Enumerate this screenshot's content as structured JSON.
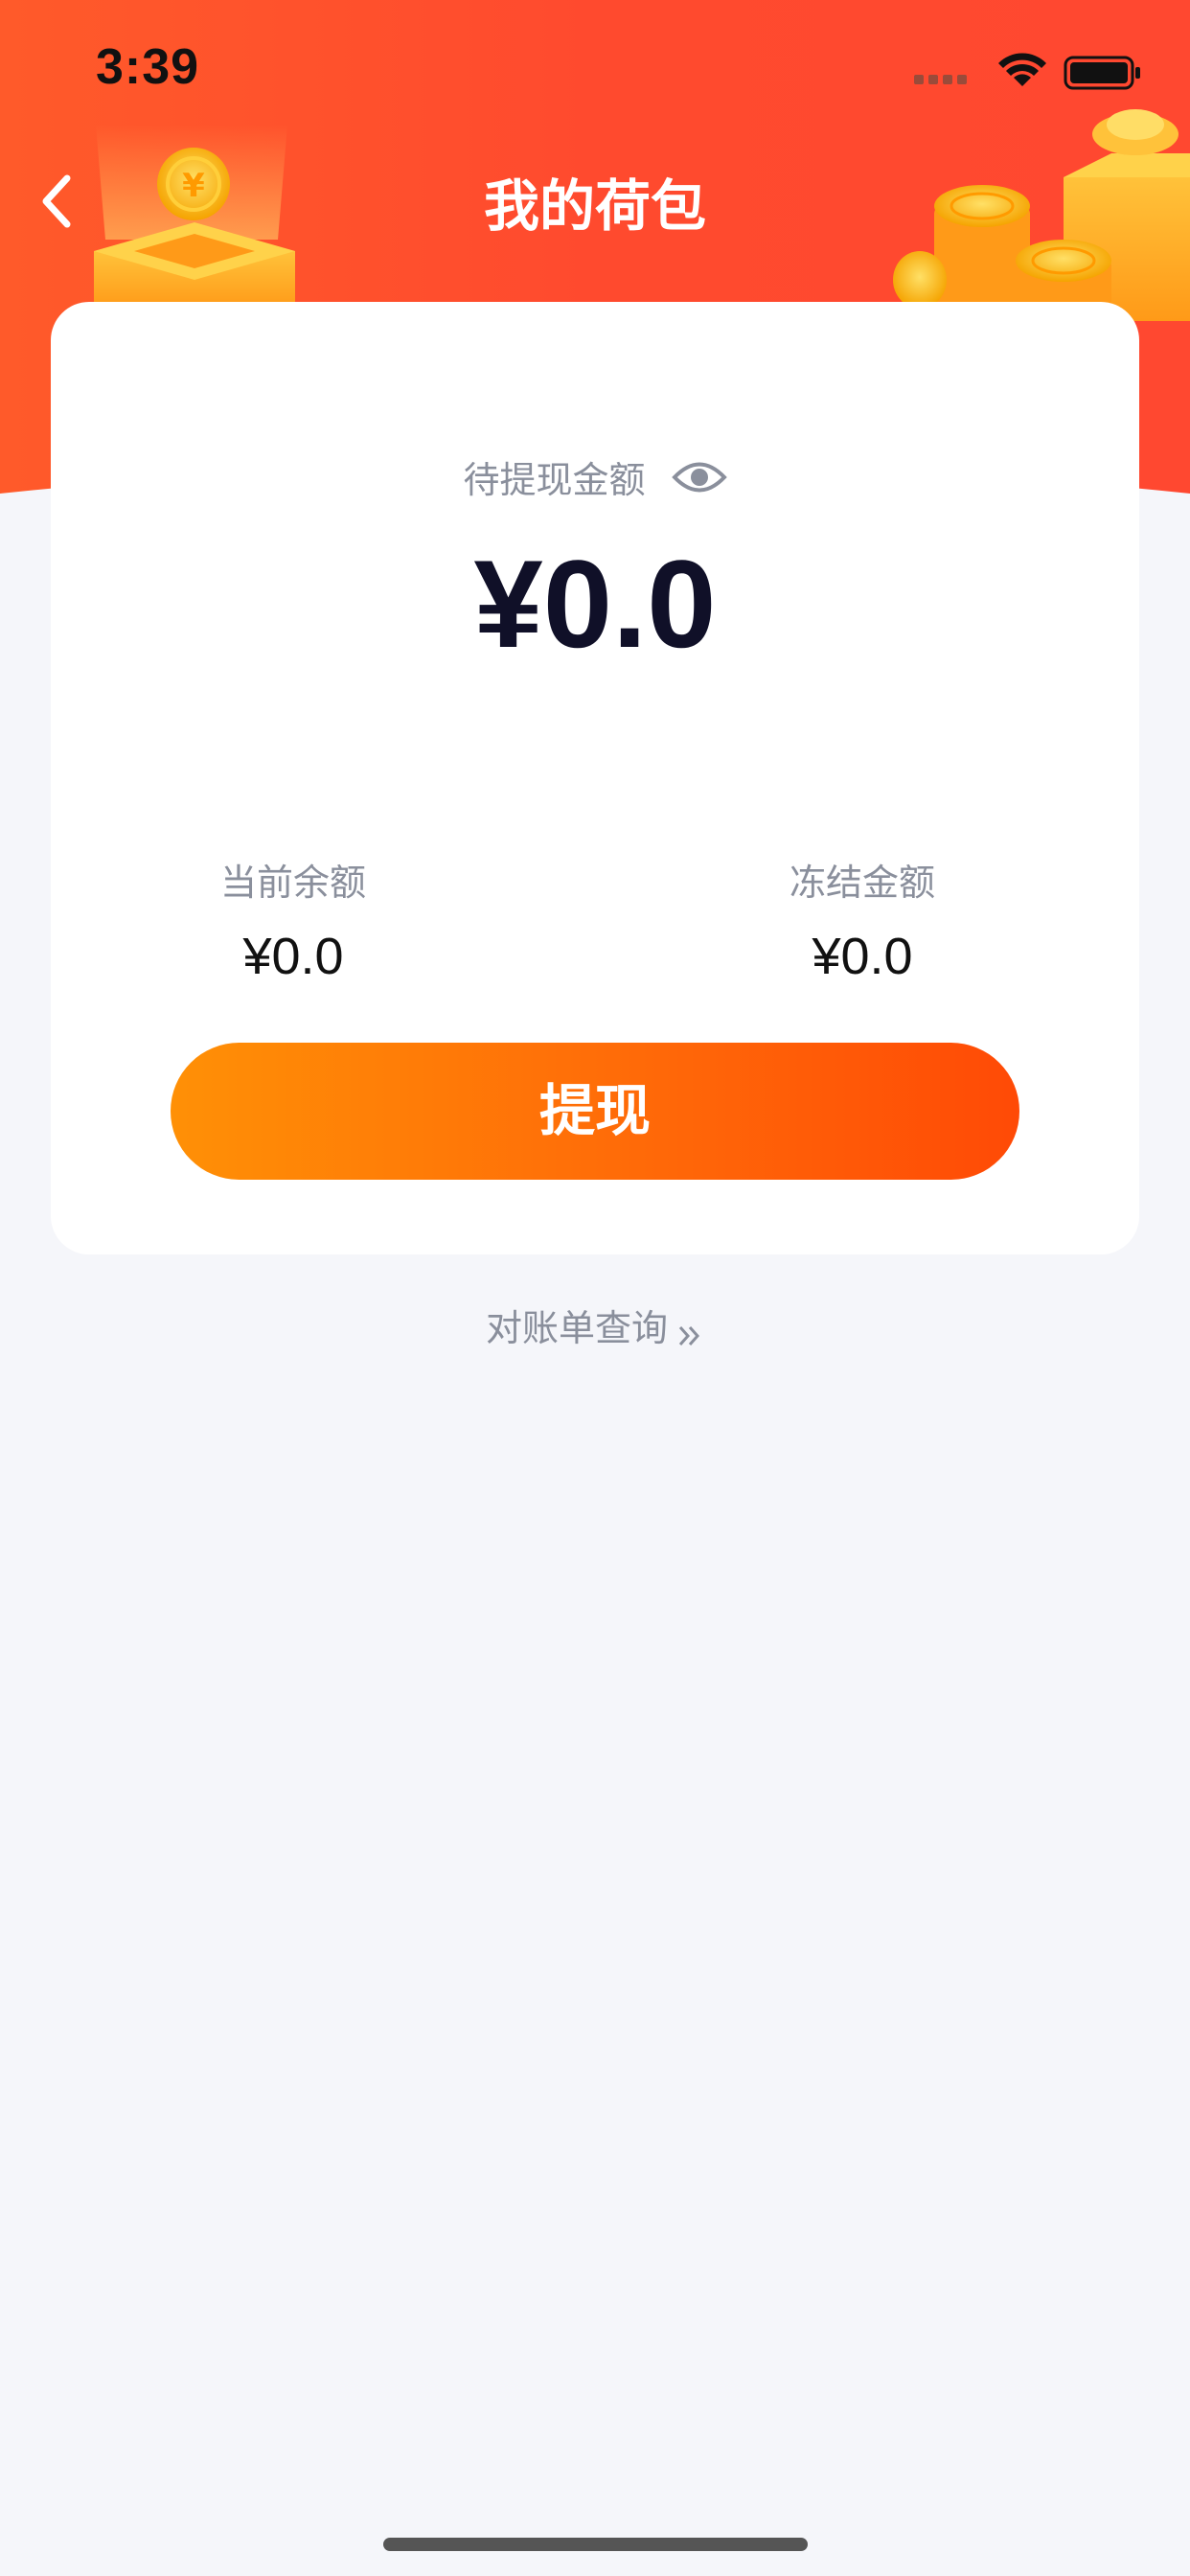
{
  "status_bar": {
    "time": "3:39",
    "icons": [
      "cellular-signal-icon",
      "wifi-icon",
      "battery-icon"
    ]
  },
  "nav": {
    "back_icon": "chevron-left-icon",
    "title": "我的荷包"
  },
  "wallet": {
    "pending_label": "待提现金额",
    "visibility_icon": "eye-icon",
    "pending_amount": "¥0.0",
    "current_balance_label": "当前余额",
    "current_balance_value": "¥0.0",
    "frozen_label": "冻结金额",
    "frozen_value": "¥0.0",
    "withdraw_label": "提现"
  },
  "statement": {
    "label": "对账单查询",
    "icon": "double-chevron-right-icon"
  },
  "colors": {
    "header_red": "#ff4a2e",
    "button_orange_start": "#ff9006",
    "button_orange_end": "#ff4a06",
    "background": "#f5f6fa"
  }
}
